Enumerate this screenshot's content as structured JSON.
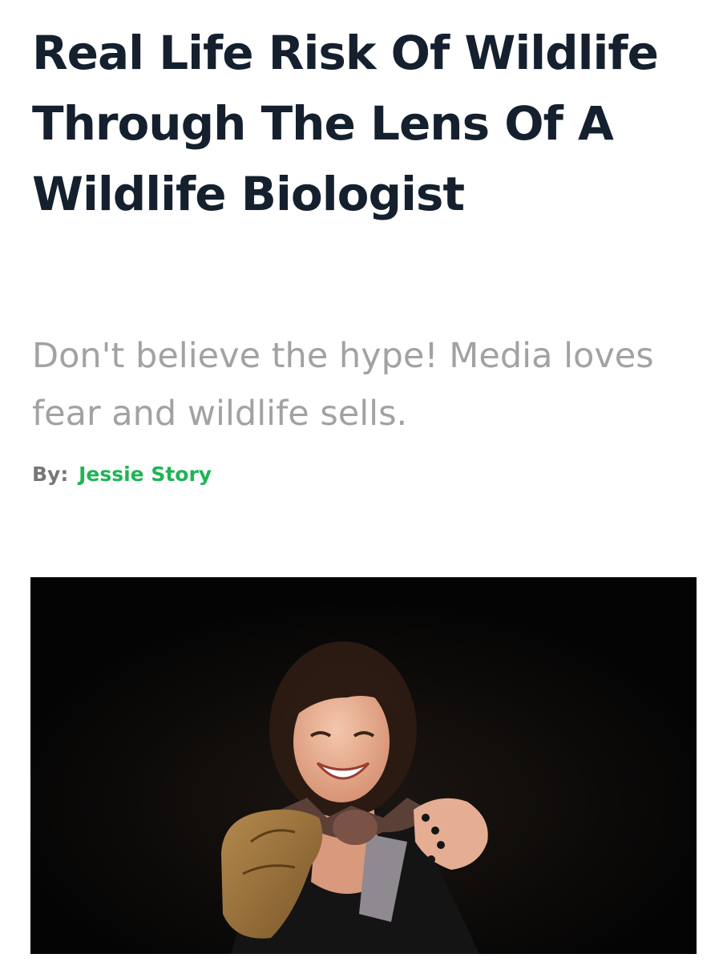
{
  "article": {
    "title": "Real Life Risk Of Wildlife Through The Lens Of A Wildlife Biologist",
    "subtitle": "Don't believe the hype! Media loves fear and wildlife sells.",
    "byline_label": "By:",
    "author": "Jessie Story"
  },
  "hero_image": {
    "subject": "smiling-woman-holding-bat-photo"
  },
  "colors": {
    "title": "#15202e",
    "subtitle": "#a2a2a2",
    "byline_label": "#777777",
    "author_link": "#1fb455",
    "image_background": "#050505"
  }
}
